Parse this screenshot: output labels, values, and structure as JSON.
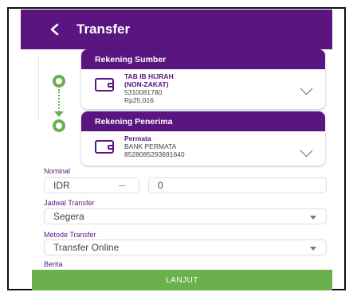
{
  "header": {
    "back_icon": "chevron-left-icon",
    "title": "Transfer"
  },
  "source_account": {
    "heading": "Rekening Sumber",
    "name_line1": "TAB IB HIJRAH",
    "name_line2": "(NON-ZAKAT)",
    "number": "5310081780",
    "balance": "Rp25.016",
    "icon": "wallet-icon"
  },
  "destination_account": {
    "heading": "Rekening Penerima",
    "name": "Permata",
    "bank": "BANK PERMATA",
    "number": "8528085293691640",
    "icon": "wallet-icon"
  },
  "form": {
    "nominal_label": "Nominal",
    "currency_value": "IDR",
    "amount_value": "0",
    "schedule_label": "Jadwal Transfer",
    "schedule_value": "Segera",
    "method_label": "Metode Transfer",
    "method_value": "Transfer Online",
    "notes_label": "Berita"
  },
  "footer": {
    "continue_label": "LANJUT"
  },
  "colors": {
    "primary": "#5a1580",
    "accent": "#6ab04c"
  }
}
